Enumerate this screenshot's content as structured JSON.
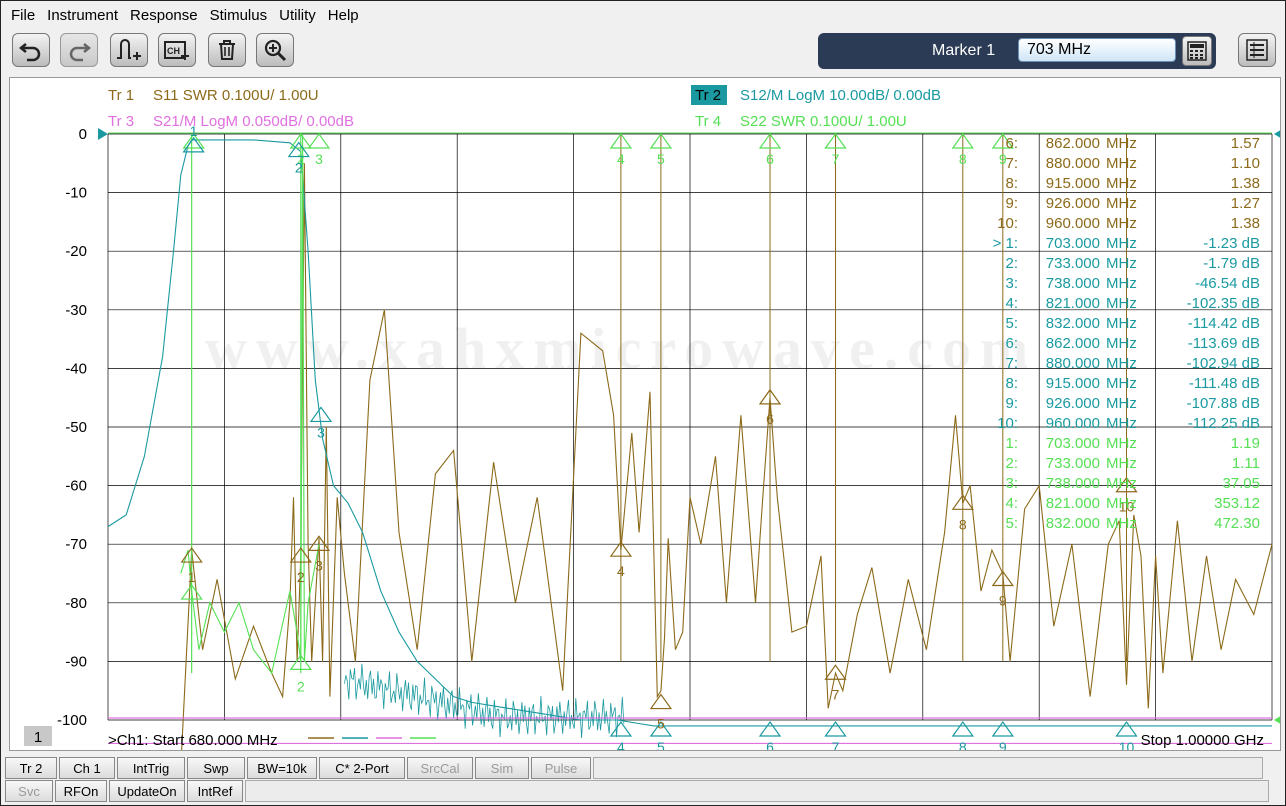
{
  "menu": [
    "File",
    "Instrument",
    "Response",
    "Stimulus",
    "Utility",
    "Help"
  ],
  "toolbar": {
    "buttons": [
      "undo-icon",
      "redo-icon",
      "add-marker-icon",
      "channel-trace-icon",
      "trash-icon",
      "zoom-icon"
    ],
    "marker_label": "Marker 1",
    "marker_value": "703 MHz"
  },
  "traces": {
    "tr1": {
      "id": "Tr 1",
      "desc": "S11 SWR 0.100U/  1.00U",
      "color": "#8c6a1a"
    },
    "tr2": {
      "id": "Tr 2",
      "desc": "S12/M LogM 10.00dB/  0.00dB",
      "color": "#1a9aa0"
    },
    "tr3": {
      "id": "Tr 3",
      "desc": "S21/M LogM 0.050dB/  0.00dB",
      "color": "#e070e0"
    },
    "tr4": {
      "id": "Tr 4",
      "desc": "S22 SWR 0.100U/  1.00U",
      "color": "#55e055"
    }
  },
  "watermark": "www.xahxmicrowave.com",
  "y_ticks": [
    "0",
    "-10",
    "-20",
    "-30",
    "-40",
    "-50",
    "-60",
    "-70",
    "-80",
    "-90",
    "-100"
  ],
  "marker_table": [
    {
      "n": "6:",
      "freq": "862.000",
      "unit": "MHz",
      "val": "1.57",
      "tr": "tr1"
    },
    {
      "n": "7:",
      "freq": "880.000",
      "unit": "MHz",
      "val": "1.10",
      "tr": "tr1"
    },
    {
      "n": "8:",
      "freq": "915.000",
      "unit": "MHz",
      "val": "1.38",
      "tr": "tr1"
    },
    {
      "n": "9:",
      "freq": "926.000",
      "unit": "MHz",
      "val": "1.27",
      "tr": "tr1"
    },
    {
      "n": "10:",
      "freq": "960.000",
      "unit": "MHz",
      "val": "1.38",
      "tr": "tr1"
    },
    {
      "n": "> 1:",
      "freq": "703.000",
      "unit": "MHz",
      "val": "-1.23 dB",
      "tr": "tr2"
    },
    {
      "n": "2:",
      "freq": "733.000",
      "unit": "MHz",
      "val": "-1.79 dB",
      "tr": "tr2"
    },
    {
      "n": "3:",
      "freq": "738.000",
      "unit": "MHz",
      "val": "-46.54 dB",
      "tr": "tr2"
    },
    {
      "n": "4:",
      "freq": "821.000",
      "unit": "MHz",
      "val": "-102.35 dB",
      "tr": "tr2"
    },
    {
      "n": "5:",
      "freq": "832.000",
      "unit": "MHz",
      "val": "-114.42 dB",
      "tr": "tr2"
    },
    {
      "n": "6:",
      "freq": "862.000",
      "unit": "MHz",
      "val": "-113.69 dB",
      "tr": "tr2"
    },
    {
      "n": "7:",
      "freq": "880.000",
      "unit": "MHz",
      "val": "-102.94 dB",
      "tr": "tr2"
    },
    {
      "n": "8:",
      "freq": "915.000",
      "unit": "MHz",
      "val": "-111.48 dB",
      "tr": "tr2"
    },
    {
      "n": "9:",
      "freq": "926.000",
      "unit": "MHz",
      "val": "-107.88 dB",
      "tr": "tr2"
    },
    {
      "n": "10:",
      "freq": "960.000",
      "unit": "MHz",
      "val": "-112.25 dB",
      "tr": "tr2"
    },
    {
      "n": "1:",
      "freq": "703.000",
      "unit": "MHz",
      "val": "1.19",
      "tr": "tr4"
    },
    {
      "n": "2:",
      "freq": "733.000",
      "unit": "MHz",
      "val": "1.11",
      "tr": "tr4"
    },
    {
      "n": "3:",
      "freq": "738.000",
      "unit": "MHz",
      "val": "37.05",
      "tr": "tr4"
    },
    {
      "n": "4:",
      "freq": "821.000",
      "unit": "MHz",
      "val": "353.12",
      "tr": "tr4"
    },
    {
      "n": "5:",
      "freq": "832.000",
      "unit": "MHz",
      "val": "472.30",
      "tr": "tr4"
    }
  ],
  "channel_number": "1",
  "start_label": ">Ch1:  Start   680.000 MHz",
  "stop_label": "Stop  1.00000 GHz",
  "marker_freqs": {
    "1": "703",
    "2": "733",
    "3": "738",
    "4": "821",
    "5": "832",
    "6": "862",
    "7": "880",
    "8": "915",
    "9": "926",
    "10": "960"
  },
  "status_row1": [
    "Tr 2",
    "Ch 1",
    "IntTrig",
    "Swp",
    "BW=10k",
    "C* 2-Port",
    "SrcCal",
    "Sim",
    "Pulse"
  ],
  "status_row2": [
    "Svc",
    "RFOn",
    "UpdateOn",
    "IntRef"
  ],
  "chart_data": {
    "type": "line",
    "x_range_mhz": [
      680,
      1000
    ],
    "y_ticks": [
      0,
      -10,
      -20,
      -30,
      -40,
      -50,
      -60,
      -70,
      -80,
      -90,
      -100
    ],
    "grid": true,
    "series": [
      {
        "name": "S11 SWR 0.100U/  1.00U",
        "color": "#8c6a1a",
        "points": [
          [
            680,
            -108
          ],
          [
            700,
            -108
          ],
          [
            703,
            -71
          ],
          [
            706,
            -88
          ],
          [
            710,
            -76
          ],
          [
            715,
            -93
          ],
          [
            720,
            -84
          ],
          [
            725,
            -92
          ],
          [
            728,
            -96
          ],
          [
            730,
            -80
          ],
          [
            731,
            -62
          ],
          [
            732,
            -90
          ],
          [
            733,
            -72
          ],
          [
            734,
            -5
          ],
          [
            735,
            -70
          ],
          [
            736,
            -90
          ],
          [
            738,
            -69
          ],
          [
            739,
            -90
          ],
          [
            740,
            -50
          ],
          [
            741,
            -96
          ],
          [
            743,
            -62
          ],
          [
            745,
            -75
          ],
          [
            748,
            -90
          ],
          [
            752,
            -42
          ],
          [
            756,
            -30
          ],
          [
            760,
            -68
          ],
          [
            765,
            -88
          ],
          [
            770,
            -58
          ],
          [
            775,
            -54
          ],
          [
            780,
            -90
          ],
          [
            786,
            -56
          ],
          [
            792,
            -80
          ],
          [
            798,
            -62
          ],
          [
            805,
            -95
          ],
          [
            810,
            -34
          ],
          [
            816,
            -37
          ],
          [
            819,
            -48
          ],
          [
            821,
            -71
          ],
          [
            824,
            -51
          ],
          [
            826,
            -68
          ],
          [
            829,
            -44
          ],
          [
            831,
            -96
          ],
          [
            832,
            -95
          ],
          [
            833,
            -86
          ],
          [
            834,
            -69
          ],
          [
            836,
            -88
          ],
          [
            838,
            -85
          ],
          [
            840,
            -62
          ],
          [
            843,
            -70
          ],
          [
            847,
            -55
          ],
          [
            850,
            -80
          ],
          [
            854,
            -48
          ],
          [
            858,
            -80
          ],
          [
            860,
            -62
          ],
          [
            862,
            -45
          ],
          [
            864,
            -62
          ],
          [
            868,
            -85
          ],
          [
            872,
            -84
          ],
          [
            876,
            -72
          ],
          [
            878,
            -98
          ],
          [
            880,
            -92
          ],
          [
            882,
            -95
          ],
          [
            886,
            -82
          ],
          [
            890,
            -74
          ],
          [
            895,
            -92
          ],
          [
            900,
            -76
          ],
          [
            905,
            -88
          ],
          [
            910,
            -68
          ],
          [
            913,
            -48
          ],
          [
            915,
            -63
          ],
          [
            917,
            -60
          ],
          [
            920,
            -78
          ],
          [
            923,
            -71
          ],
          [
            926,
            -75
          ],
          [
            928,
            -90
          ],
          [
            932,
            -64
          ],
          [
            936,
            -60
          ],
          [
            940,
            -84
          ],
          [
            945,
            -70
          ],
          [
            950,
            -96
          ],
          [
            955,
            -70
          ],
          [
            958,
            -66
          ],
          [
            960,
            -94
          ],
          [
            962,
            -65
          ],
          [
            964,
            -72
          ],
          [
            966,
            -98
          ],
          [
            968,
            -72
          ],
          [
            970,
            -92
          ],
          [
            974,
            -66
          ],
          [
            978,
            -90
          ],
          [
            982,
            -72
          ],
          [
            986,
            -88
          ],
          [
            990,
            -76
          ],
          [
            995,
            -82
          ],
          [
            1000,
            -70
          ]
        ]
      },
      {
        "name": "S12/M LogM 10.00dB/  0.00dB",
        "color": "#1a9aa0",
        "points": [
          [
            680,
            -67
          ],
          [
            685,
            -65
          ],
          [
            690,
            -55
          ],
          [
            695,
            -38
          ],
          [
            698,
            -20
          ],
          [
            700,
            -7
          ],
          [
            702,
            -2
          ],
          [
            703,
            -1
          ],
          [
            710,
            -1
          ],
          [
            720,
            -1
          ],
          [
            730,
            -1.5
          ],
          [
            733,
            -3
          ],
          [
            735,
            -20
          ],
          [
            737,
            -42
          ],
          [
            739,
            -52
          ],
          [
            742,
            -60
          ],
          [
            746,
            -63
          ],
          [
            750,
            -68
          ],
          [
            755,
            -78
          ],
          [
            760,
            -85
          ],
          [
            765,
            -90
          ],
          [
            770,
            -93
          ],
          [
            775,
            -96
          ],
          [
            780,
            -97
          ],
          [
            790,
            -98
          ],
          [
            800,
            -99
          ],
          [
            810,
            -100
          ],
          [
            820,
            -100
          ],
          [
            830,
            -101
          ],
          [
            850,
            -101
          ],
          [
            880,
            -101
          ],
          [
            920,
            -101
          ],
          [
            960,
            -101
          ],
          [
            1000,
            -101
          ]
        ]
      },
      {
        "name": "S21/M LogM 0.050dB/  0.00dB",
        "color": "#e070e0",
        "points": [
          [
            680,
            -104
          ],
          [
            1000,
            -104
          ]
        ]
      },
      {
        "name": "S22 SWR 0.100U/  1.00U",
        "color": "#55e055",
        "points": [
          [
            700,
            -75
          ],
          [
            702,
            -71
          ],
          [
            703,
            -78
          ],
          [
            705,
            -88
          ],
          [
            708,
            -80
          ],
          [
            712,
            -85
          ],
          [
            716,
            -80
          ],
          [
            720,
            -88
          ],
          [
            725,
            -92
          ],
          [
            730,
            -78
          ],
          [
            732,
            -85
          ],
          [
            733,
            -90
          ],
          [
            733.5,
            0
          ],
          [
            734,
            -90
          ],
          [
            735,
            -80
          ],
          [
            738,
            -70
          ]
        ]
      }
    ]
  }
}
